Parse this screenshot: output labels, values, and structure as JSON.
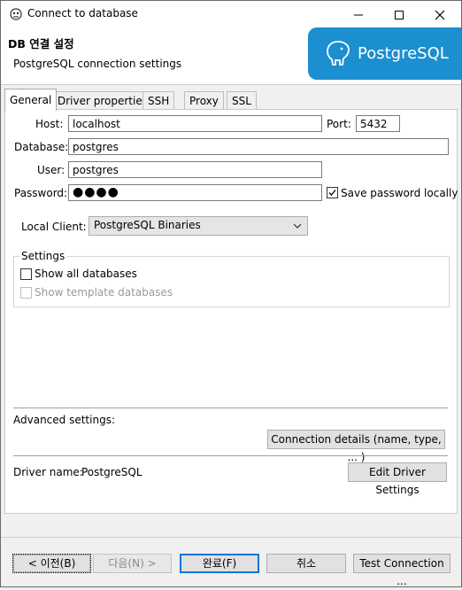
{
  "window": {
    "title": "Connect to database",
    "minimize": "—",
    "maximize": "☐",
    "close": "✕"
  },
  "header": {
    "title": "DB 연결 설정",
    "subtitle": "PostgreSQL connection settings",
    "logo_text": "PostgreSQL"
  },
  "tabs": [
    {
      "label": "General"
    },
    {
      "label": "Driver properties"
    },
    {
      "label": "SSH"
    },
    {
      "label": "Proxy"
    },
    {
      "label": "SSL"
    }
  ],
  "form": {
    "host_label": "Host:",
    "host_value": "localhost",
    "port_label": "Port:",
    "port_value": "5432",
    "database_label": "Database:",
    "database_value": "postgres",
    "user_label": "User:",
    "user_value": "postgres",
    "password_label": "Password:",
    "password_value": "●●●●",
    "save_password_label": "Save password locally",
    "save_password_checked": true,
    "local_client_label": "Local Client:",
    "local_client_value": "PostgreSQL Binaries"
  },
  "settings": {
    "group_label": "Settings",
    "show_all_label": "Show all databases",
    "show_template_label": "Show template databases"
  },
  "advanced": {
    "label": "Advanced settings:",
    "connection_details_button": "Connection details (name, type, ... )"
  },
  "driver": {
    "name_label": "Driver name:",
    "name_value": "PostgreSQL",
    "edit_button": "Edit Driver Settings"
  },
  "footer": {
    "back_button": "< 이전(B)",
    "next_button": "다음(N) >",
    "finish_button": "완료(F)",
    "cancel_button": "취소",
    "test_button": "Test Connection ..."
  }
}
